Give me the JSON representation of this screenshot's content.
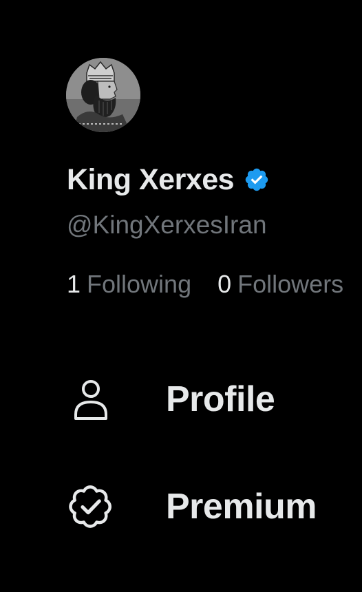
{
  "profile": {
    "display_name": "King Xerxes",
    "handle": "@KingXerxesIran",
    "verified": true,
    "verified_badge_color": "#1d9bf0",
    "avatar_icon": "avatar-portrait"
  },
  "stats": {
    "following_count": "1",
    "following_label": "Following",
    "followers_count": "0",
    "followers_label": "Followers"
  },
  "nav": {
    "items": [
      {
        "label": "Profile",
        "icon": "person-outline-icon"
      },
      {
        "label": "Premium",
        "icon": "verified-badge-outline-icon"
      }
    ]
  },
  "colors": {
    "background": "#000000",
    "primary_text": "#e7e9ea",
    "secondary_text": "#71767b"
  }
}
